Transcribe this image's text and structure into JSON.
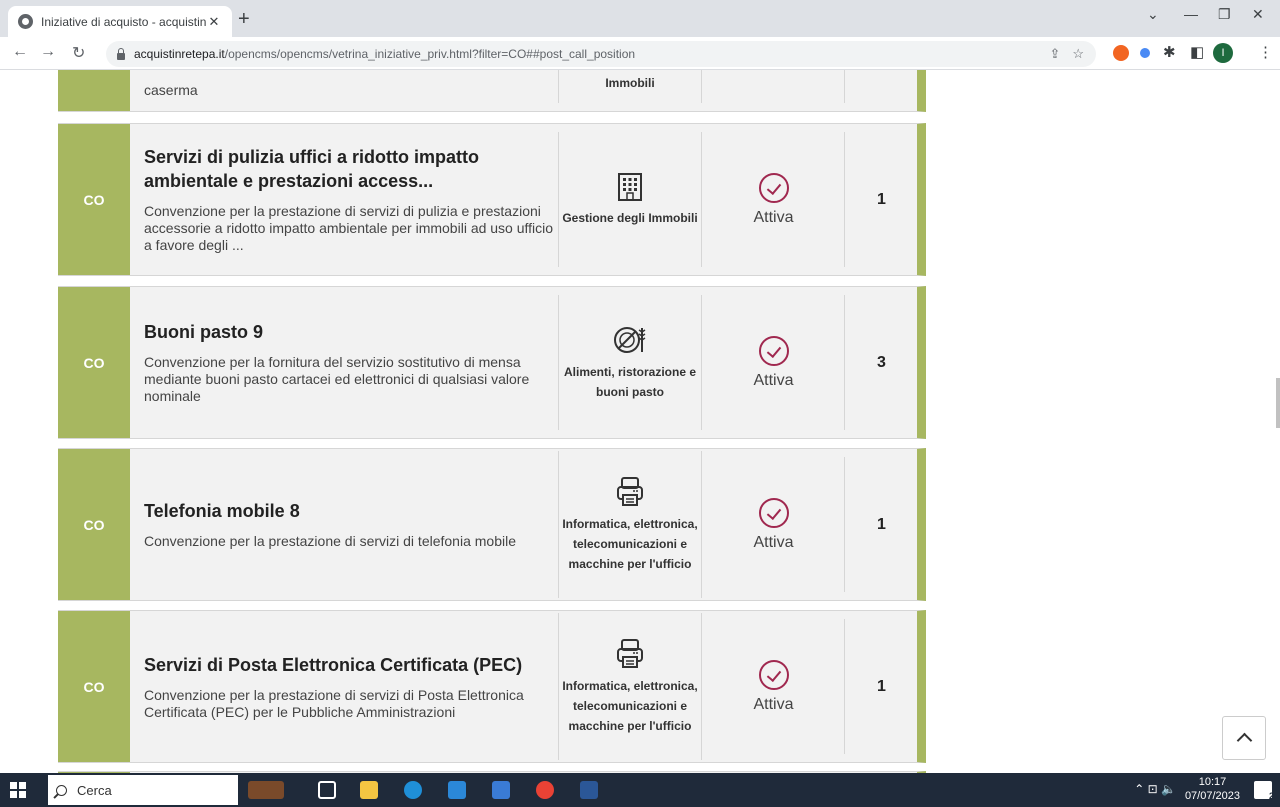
{
  "browser": {
    "tab_title": "Iniziative di acquisto - acquistinre",
    "tab_close": "✕",
    "new_tab": "+",
    "url_host": "acquistinretepa.it",
    "url_path": "/opencms/opencms/vetrina_iniziative_priv.html?filter=CO##post_call_position",
    "profile_initial": "I"
  },
  "partial_top": {
    "desc_tail": "caserma",
    "cat_tail": "Immobili"
  },
  "cards": [
    {
      "code": "CO",
      "title": "Servizi di pulizia uffici a ridotto impatto ambientale e prestazioni access...",
      "description": "Convenzione per la prestazione di servizi di pulizia e prestazioni accessorie a ridotto impatto ambientale per immobili ad uso ufficio a favore degli ...",
      "category": "Gestione degli Immobili",
      "category_icon": "building-icon",
      "status": "Attiva",
      "count": "1"
    },
    {
      "code": "CO",
      "title": "Buoni pasto 9",
      "description": "Convenzione per la fornitura del servizio sostitutivo di mensa mediante buoni pasto cartacei ed elettronici di qualsiasi valore nominale",
      "category": "Alimenti, ristorazione e buoni pasto",
      "category_icon": "food-icon",
      "status": "Attiva",
      "count": "3"
    },
    {
      "code": "CO",
      "title": "Telefonia mobile 8",
      "description": "Convenzione per la prestazione di servizi di telefonia mobile",
      "category": "Informatica, elettronica, telecomunicazioni e macchine per l'ufficio",
      "category_icon": "printer-icon",
      "status": "Attiva",
      "count": "1"
    },
    {
      "code": "CO",
      "title": "Servizi di Posta Elettronica Certificata (PEC)",
      "description": "Convenzione per la prestazione di servizi di Posta Elettronica Certificata (PEC) per le Pubbliche Amministrazioni",
      "category": "Informatica, elettronica, telecomunicazioni e macchine per l'ufficio",
      "category_icon": "printer-icon",
      "status": "Attiva",
      "count": "1"
    }
  ],
  "taskbar": {
    "search_label": "Cerca",
    "time": "10:17",
    "date": "07/07/2023",
    "notif_count": "2"
  },
  "colors": {
    "accent_green": "#a7b760",
    "status_check": "#a0284f"
  }
}
